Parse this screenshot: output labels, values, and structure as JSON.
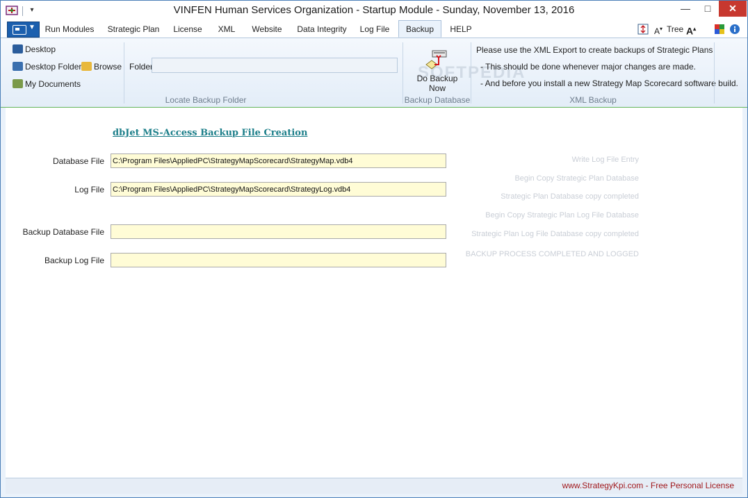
{
  "window": {
    "title": "VINFEN Human Services Organization  - Startup Module - Sunday, November 13, 2016",
    "minimize": "—",
    "maximize": "□",
    "close": "✕"
  },
  "tabs": [
    {
      "label": "Run Modules"
    },
    {
      "label": "Strategic Plan"
    },
    {
      "label": "License"
    },
    {
      "label": "XML"
    },
    {
      "label": "Website"
    },
    {
      "label": "Data Integrity"
    },
    {
      "label": "Log File"
    },
    {
      "label": "Backup",
      "active": true
    },
    {
      "label": "HELP"
    }
  ],
  "tab_right": {
    "tree_label": "Tree",
    "font_up": "A",
    "font_down": "A"
  },
  "ribbon": {
    "locate": {
      "desktop": "Desktop",
      "desktop_folder": "Desktop Folder",
      "browse": "Browse",
      "my_documents": "My Documents",
      "folder_label": "Folder",
      "folder_value": "",
      "group_label": "Locate Backup Folder"
    },
    "backup": {
      "button_label": "Do Backup Now",
      "group_label": "Backup Database"
    },
    "xml": {
      "line1": "Please use the XML Export to create backups of Strategic Plans",
      "line2": "- This should be done whenever major changes are made.",
      "line3": "- And before you install a new Strategy Map Scorecard software build.",
      "group_label": "XML Backup"
    }
  },
  "main": {
    "heading": "dbJet MS-Access Backup File Creation",
    "fields": {
      "database_file_label": "Database File",
      "database_file_value": "C:\\Program Files\\AppliedPC\\StrategyMapScorecard\\StrategyMap.vdb4",
      "log_file_label": "Log File",
      "log_file_value": "C:\\Program Files\\AppliedPC\\StrategyMapScorecard\\StrategyLog.vdb4",
      "backup_database_file_label": "Backup Database File",
      "backup_database_file_value": "",
      "backup_log_file_label": "Backup Log File",
      "backup_log_file_value": ""
    },
    "status_steps": [
      "Write Log File Entry",
      "Begin Copy Strategic Plan Database",
      "Strategic Plan Database copy completed",
      "Begin Copy Strategic Plan Log File Database",
      "Strategic Plan Log File Database copy completed",
      "BACKUP PROCESS COMPLETED AND LOGGED"
    ]
  },
  "statusbar": {
    "license": "www.StrategyKpi.com - Free Personal License"
  },
  "colors": {
    "accent": "#1b5fae",
    "heading": "#1d7f8a",
    "license": "#a0181c",
    "input_bg": "#fffcd6"
  }
}
